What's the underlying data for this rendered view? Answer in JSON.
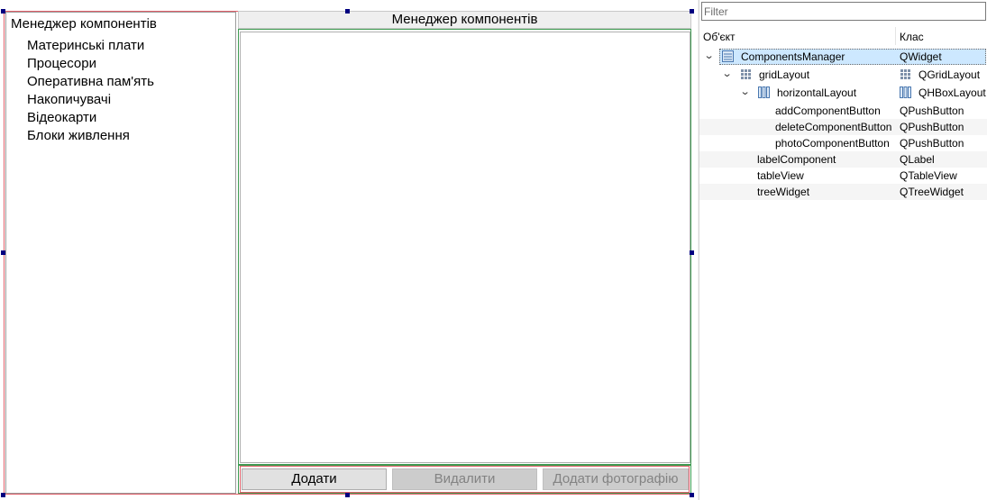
{
  "form": {
    "tree_widget": {
      "header": "Менеджер компонентів",
      "items": [
        "Материнські плати",
        "Процесори",
        "Оперативна пам'ять",
        "Накопичувачі",
        "Відеокарти",
        "Блоки живлення"
      ]
    },
    "label_component": "Менеджер компонентів",
    "buttons": {
      "add": "Додати",
      "delete": "Видалити",
      "photo": "Додати фотографію"
    }
  },
  "inspector": {
    "filter_placeholder": "Filter",
    "columns": {
      "object": "Об'єкт",
      "class": "Клас"
    },
    "rows": [
      {
        "object": "ComponentsManager",
        "class": "QWidget",
        "icon": "widget-icon"
      },
      {
        "object": "gridLayout",
        "class": "QGridLayout",
        "icon": "grid-layout-icon"
      },
      {
        "object": "horizontalLayout",
        "class": "QHBoxLayout",
        "icon": "hbox-layout-icon"
      },
      {
        "object": "addComponentButton",
        "class": "QPushButton"
      },
      {
        "object": "deleteComponentButton",
        "class": "QPushButton"
      },
      {
        "object": "photoComponentButton",
        "class": "QPushButton"
      },
      {
        "object": "labelComponent",
        "class": "QLabel"
      },
      {
        "object": "tableView",
        "class": "QTableView"
      },
      {
        "object": "treeWidget",
        "class": "QTreeWidget"
      }
    ]
  },
  "colors": {
    "selection": "#cde8ff",
    "layout_outline": "#e0606a",
    "grid_outline": "#3f9b52",
    "handle": "#000080"
  }
}
